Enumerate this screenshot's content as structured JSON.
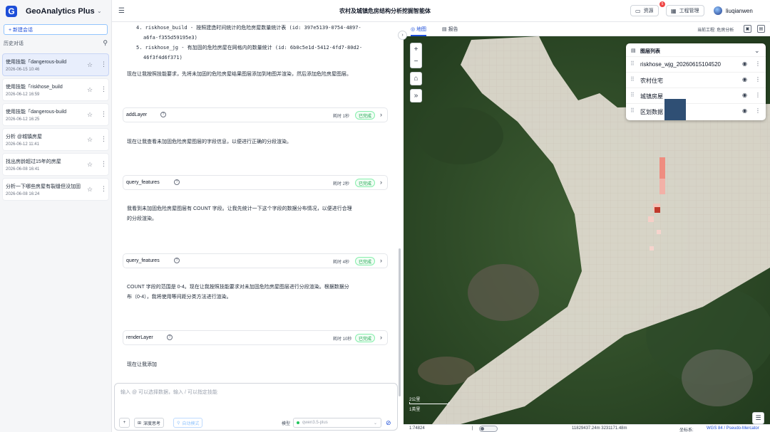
{
  "app": {
    "name": "GeoAnalytics Plus",
    "logo_letter": "G"
  },
  "sidebar": {
    "new_chat_label": "+ 新建会话",
    "history_label": "历史对话",
    "conversations": [
      {
        "title": "使用技能「dangerous-build",
        "time": "2026-06-15 10:46"
      },
      {
        "title": "使用技能「riskhose_build",
        "time": "2026-06-12 16:59"
      },
      {
        "title": "使用技能「dangerous-build",
        "time": "2026-06-12 16:25"
      },
      {
        "title": "分析 @城镇房屋",
        "time": "2026-06-12 11:41"
      },
      {
        "title": "找出房龄超过15年的房屋",
        "time": "2026-06-08 16:41"
      },
      {
        "title": "分析一下哪些房屋有裂缝但没加固",
        "time": "2026-06-08 16:24"
      }
    ]
  },
  "header": {
    "title": "农村及城镇危房结构分析挖掘智能体",
    "resource_label": "资源",
    "resource_badge": "5",
    "project_label": "工程管理",
    "username": "liuqianwen"
  },
  "chat": {
    "list_item_4": "4. riskhose_build - 按照建造时间统计的危险房屋数量统计表 (id: 397e5139-0754-4897-",
    "list_item_4_cont": "a6fa-f355d59195e3)",
    "list_item_5": "5. riskhose_jg - 有加固的危险房屋在网格内的数量统计 (id: 6b0c5e1d-5412-4fd7-80d2-",
    "list_item_5_cont": "46f3f4d6f371)",
    "msg1": "现在让我按照技能要求，先将未加固的危险房屋结果图层添加到地图并渲染，然后添加危险房屋图层。",
    "msg2": "现在让我查看未加固危险房屋图层的字段信息，以便进行正确的分段渲染。",
    "msg3_line1": "我看到未加固危险房屋图层有 COUNT 字段。让我先统计一下这个字段的数据分布情况，以便进行合理",
    "msg3_line2": "的分段渲染。",
    "msg4_line1": "COUNT 字段的范围是 0-4。现在让我按照技能要求对未加固危险房屋图层进行分段渲染。根据数据分",
    "msg4_line2": "布（0-4），我将使用等间距分类方法进行渲染。",
    "msg5": "现在让我添加",
    "tools": [
      {
        "name": "addLayer",
        "time": "耗时 1秒",
        "status": "已完成"
      },
      {
        "name": "query_features",
        "time": "耗时 2秒",
        "status": "已完成"
      },
      {
        "name": "query_features",
        "time": "耗时 4秒",
        "status": "已完成"
      },
      {
        "name": "renderLayer",
        "time": "耗时 10秒",
        "status": "已完成"
      }
    ]
  },
  "composer": {
    "placeholder": "输入 @ 可以选择数据，输入 / 可以指定技能",
    "add_label": "+",
    "deep_think_label": "深度思考",
    "auto_mode_label": "自动模式",
    "model_label": "模型",
    "model_value": "qwen3.5-plus"
  },
  "map_panel": {
    "tab_map": "地图",
    "tab_report": "报告",
    "current_project": "当前工程: 危房分析",
    "layers_title": "图层列表",
    "layers": [
      {
        "name": "riskhose_wjg_20260615104520"
      },
      {
        "name": "农村住宅"
      },
      {
        "name": "城镇房屋"
      },
      {
        "name": "区划数据"
      }
    ],
    "scale_km": "2公里",
    "scale_mi": "1英里",
    "status": {
      "scale": "1:74824",
      "coords": "11829437.24m  3231171.48m",
      "crs_label": "坐标系:",
      "crs_value": "WGS 84 / Pseudo-Mercator"
    }
  },
  "colors": {
    "accent": "#1d4ed8",
    "success": "#16a34a"
  }
}
